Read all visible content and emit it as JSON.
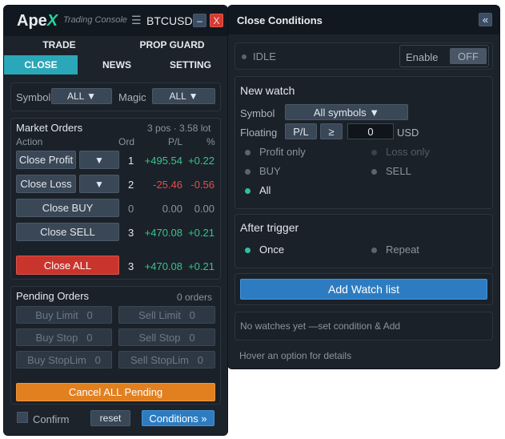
{
  "left": {
    "brand": "Ape",
    "brand_x": "X",
    "brand_sub": "Trading Console",
    "menu_glyph": "☰",
    "symbol": "BTCUSD",
    "min_label": "–",
    "close_label": "X",
    "tabs": {
      "trade": "TRADE",
      "prop_guard": "PROP GUARD",
      "close": "CLOSE",
      "news": "NEWS",
      "setting": "SETTING"
    },
    "filter": {
      "symbol_label": "Symbol",
      "symbol_value": "ALL ▼",
      "magic_label": "Magic",
      "magic_value": "ALL ▼"
    },
    "market": {
      "title": "Market Orders",
      "summary": "3 pos · 3.58 lot",
      "col_action": "Action",
      "col_ord": "Ord",
      "col_pl": "P/L",
      "col_pct": "%",
      "rows": [
        {
          "label": "Close Profit",
          "dropdown": "▼",
          "ord": "1",
          "pl": "+495.54",
          "pct": "+0.22"
        },
        {
          "label": "Close Loss",
          "dropdown": "▼",
          "ord": "2",
          "pl": "-25.46",
          "pct": "-0.56"
        },
        {
          "label": "Close BUY",
          "ord": "0",
          "pl": "0.00",
          "pct": "0.00"
        },
        {
          "label": "Close SELL",
          "ord": "3",
          "pl": "+470.08",
          "pct": "+0.21"
        }
      ],
      "close_all": {
        "label": "Close ALL",
        "ord": "3",
        "pl": "+470.08",
        "pct": "+0.21"
      }
    },
    "pending": {
      "title": "Pending Orders",
      "count": "0 orders",
      "buttons": [
        {
          "label": "Buy Limit",
          "n": "0"
        },
        {
          "label": "Sell Limit",
          "n": "0"
        },
        {
          "label": "Buy Stop",
          "n": "0"
        },
        {
          "label": "Sell Stop",
          "n": "0"
        },
        {
          "label": "Buy StopLim",
          "n": "0"
        },
        {
          "label": "Sell StopLim",
          "n": "0"
        }
      ],
      "cancel_all": "Cancel ALL Pending"
    },
    "footer": {
      "confirm": "Confirm",
      "reset": "reset",
      "conditions": "Conditions »"
    }
  },
  "right": {
    "title": "Close Conditions",
    "collapse_glyph": "«",
    "status": "IDLE",
    "enable_label": "Enable",
    "enable_value": "OFF",
    "new_watch": {
      "title": "New watch",
      "symbol_label": "Symbol",
      "symbol_value": "All symbols ▼",
      "floating_label": "Floating",
      "pl_button": "P/L",
      "op_button": "≥",
      "amount": "0",
      "currency": "USD",
      "options": {
        "profit_only": "Profit only",
        "loss_only": "Loss only",
        "buy": "BUY",
        "sell": "SELL",
        "all": "All"
      }
    },
    "after_trigger": {
      "title": "After trigger",
      "once": "Once",
      "repeat": "Repeat"
    },
    "add_button": "Add Watch list",
    "empty_text": "No watches yet —set condition & Add",
    "hint": "Hover an option for details"
  },
  "colors": {
    "accent": "#2aa7b8",
    "close_all": "#c9352d",
    "cancel": "#e2801f",
    "blue_button": "#2d7cc1",
    "profit": "#37c48a",
    "loss": "#e04f4f"
  }
}
